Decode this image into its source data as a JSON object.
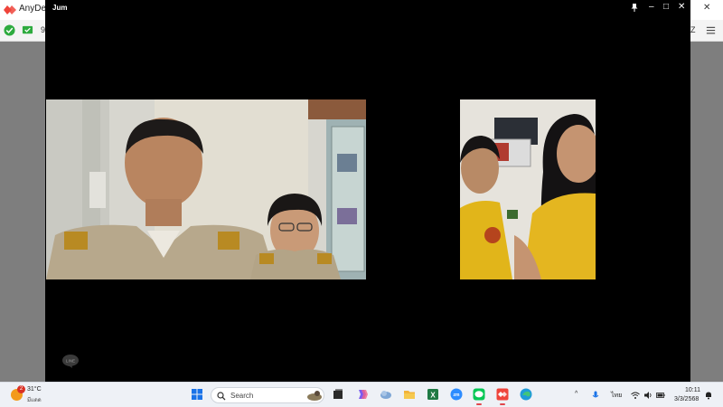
{
  "anydesk": {
    "title": "AnyDes",
    "toolbar_fragment": "9",
    "right_fragment_1": "k",
    "right_fragment_2": "Z"
  },
  "call_window": {
    "title": "Jum",
    "controls": [
      "pin-icon",
      "minimize-icon",
      "maximize-icon",
      "close-icon"
    ],
    "videos": [
      {
        "id": "main",
        "label": ""
      },
      {
        "id": "secondary",
        "label": ""
      }
    ],
    "watermark": "LINE"
  },
  "taskbar": {
    "weather": {
      "temp": "31°C",
      "condition": "มีแดด",
      "badge": "2"
    },
    "search_placeholder": "Search",
    "apps": [
      "windows-start",
      "task-view",
      "copilot",
      "app-4",
      "file-explorer",
      "excel",
      "zoom",
      "line",
      "anydesk",
      "edge"
    ],
    "tray": {
      "lang": "ไทย",
      "time": "10:11",
      "date": "3/3/2568"
    }
  },
  "colors": {
    "anydesk_red": "#ef443b",
    "line_green": "#06c755",
    "taskbar_bg": "#eef1f6"
  }
}
